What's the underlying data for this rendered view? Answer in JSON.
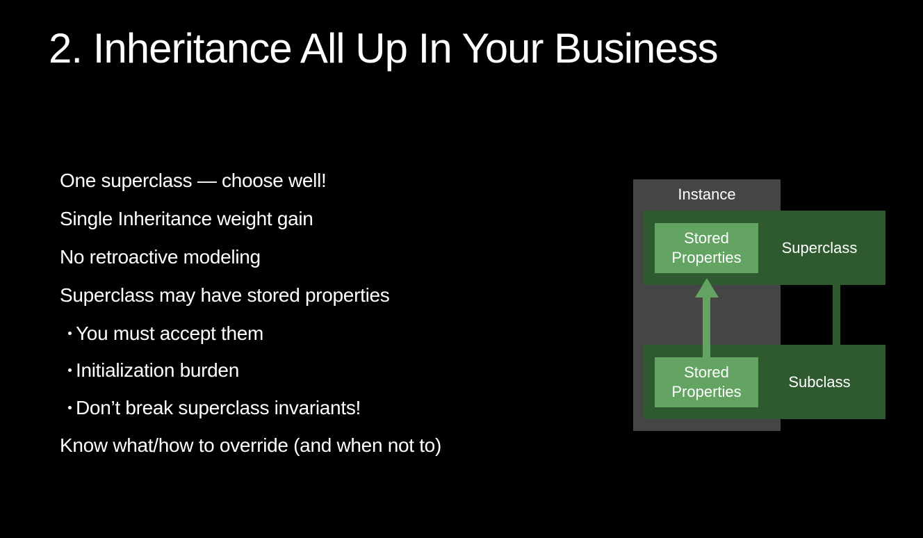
{
  "slide": {
    "title": "2. Inheritance All Up In Your Business",
    "bullets": [
      "One superclass — choose well!",
      "Single Inheritance weight gain",
      "No retroactive modeling",
      "Superclass may have stored properties"
    ],
    "sub_bullets": [
      "You must accept them",
      "Initialization burden",
      "Don’t break superclass invariants!"
    ],
    "final_bullet": "Know what/how to override (and when not to)"
  },
  "diagram": {
    "instance_label": "Instance",
    "superclass_label": "Superclass",
    "subclass_label": "Subclass",
    "stored_properties_label": "Stored\nProperties",
    "colors": {
      "background": "#000000",
      "instance_box": "#454545",
      "class_box": "#2f5a2f",
      "stored_box": "#63a463",
      "text": "#ffffff"
    }
  }
}
